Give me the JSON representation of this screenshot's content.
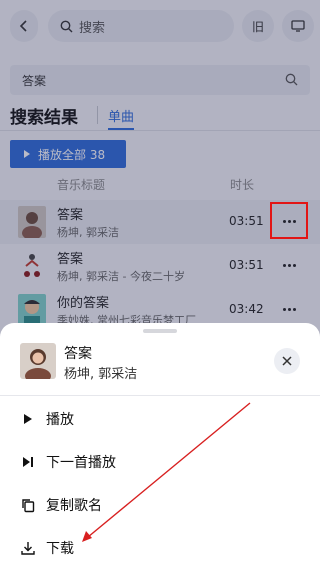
{
  "header": {
    "search_placeholder": "搜索",
    "btn_old": "旧"
  },
  "query": "答案",
  "results": {
    "title": "搜索结果",
    "tab": "单曲",
    "play_all": "播放全部 38",
    "col_title": "音乐标题",
    "col_duration": "时长"
  },
  "songs": [
    {
      "name": "答案",
      "artist": "杨坤, 郭采洁",
      "duration": "03:51"
    },
    {
      "name": "答案",
      "artist": "杨坤, 郭采洁 - 今夜二十岁",
      "duration": "03:51"
    },
    {
      "name": "你的答案",
      "artist": "季妙姝, 常州七彩音乐梦工厂",
      "duration": "03:42"
    }
  ],
  "sheet": {
    "title": "答案",
    "artist": "杨坤, 郭采洁",
    "menu": [
      {
        "label": "播放",
        "icon": "play-icon"
      },
      {
        "label": "下一首播放",
        "icon": "play-next-icon"
      },
      {
        "label": "复制歌名",
        "icon": "copy-icon"
      },
      {
        "label": "下载",
        "icon": "download-icon"
      }
    ]
  },
  "colors": {
    "accent": "#2d6ad9",
    "highlight_box": "#e21515",
    "arrow": "#d82020"
  }
}
